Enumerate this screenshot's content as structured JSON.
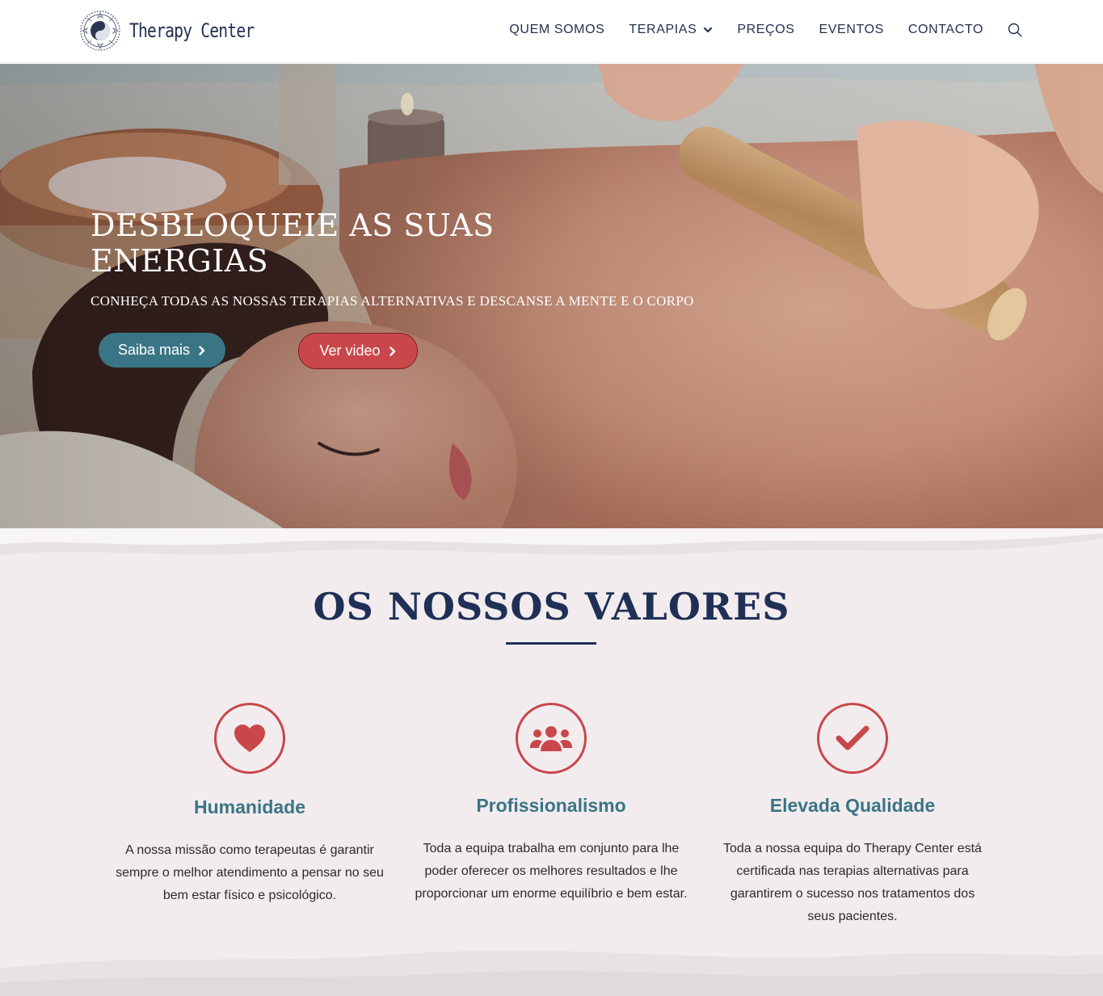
{
  "header": {
    "logo_text": "Therapy Center",
    "nav": [
      {
        "label": "QUEM SOMOS"
      },
      {
        "label": "TERAPIAS"
      },
      {
        "label": "PREÇOS"
      },
      {
        "label": "EVENTOS"
      },
      {
        "label": "CONTACTO"
      }
    ]
  },
  "hero": {
    "title": "DESBLOQUEIE AS SUAS ENERGIAS",
    "subtitle": "CONHEÇA TODAS AS NOSSAS TERAPIAS ALTERNATIVAS E DESCANSE A MENTE E O CORPO",
    "primary_button": "Saiba mais",
    "secondary_button": "Ver video"
  },
  "values": {
    "title": "OS NOSSOS VALORES",
    "cards": [
      {
        "icon": "heart-icon",
        "title": "Humanidade",
        "text": "A nossa missão como terapeutas é garantir sempre o melhor atendimento a pensar no seu bem estar físico e psicológico."
      },
      {
        "icon": "users-icon",
        "title": "Profissionalismo",
        "text": "Toda a equipa trabalha em conjunto para lhe poder oferecer os melhores resultados e lhe proporcionar um enorme equilíbrio e bem estar."
      },
      {
        "icon": "check-icon",
        "title": "Elevada Qualidade",
        "text": "Toda a nossa equipa do Therapy Center está certificada nas terapias alternativas para garantirem o sucesso nos tratamentos dos seus pacientes."
      }
    ]
  },
  "colors": {
    "navy": "#1f3057",
    "teal": "#3a7585",
    "accent_red": "#c9474a",
    "section_bg": "#f3ecee"
  }
}
